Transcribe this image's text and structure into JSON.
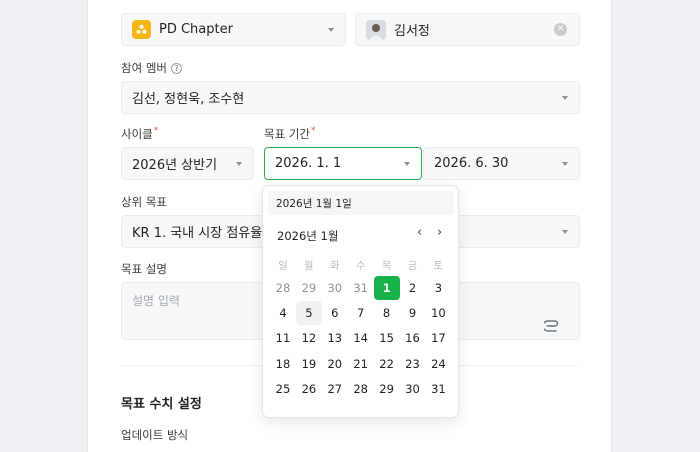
{
  "team_select": {
    "value": "PD Chapter",
    "icon": "team-icon"
  },
  "owner_select": {
    "value": "김서정",
    "icon": "avatar"
  },
  "members": {
    "label": "참여 멤버",
    "value": "김선, 정현욱, 조수현"
  },
  "cycle": {
    "label": "사이클",
    "value": "2026년 상반기"
  },
  "period": {
    "label": "목표 기간",
    "start": "2026. 1. 1",
    "end": "2026. 6. 30"
  },
  "parent_goal": {
    "label": "상위 목표",
    "value": "KR 1. 국내 시장 점유율 15% 🞄"
  },
  "description": {
    "label": "목표 설명",
    "placeholder": "설명 입력"
  },
  "metric_section": {
    "title": "목표 수치 설정",
    "update_label": "업데이트 방식"
  },
  "date_picker": {
    "input_value": "2026년 1월 1일",
    "month_title": "2026년 1월",
    "prev": "‹",
    "next": "›",
    "weekdays": [
      "일",
      "월",
      "화",
      "수",
      "목",
      "금",
      "토"
    ],
    "weeks": [
      [
        "28",
        "29",
        "30",
        "31",
        "1",
        "2",
        "3"
      ],
      [
        "4",
        "5",
        "6",
        "7",
        "8",
        "9",
        "10"
      ],
      [
        "11",
        "12",
        "13",
        "14",
        "15",
        "16",
        "17"
      ],
      [
        "18",
        "19",
        "20",
        "21",
        "22",
        "23",
        "24"
      ],
      [
        "25",
        "26",
        "27",
        "28",
        "29",
        "30",
        "31"
      ]
    ],
    "selected": "1",
    "accent_color": "#18b24b",
    "focus_border_color": "#27b14e"
  }
}
